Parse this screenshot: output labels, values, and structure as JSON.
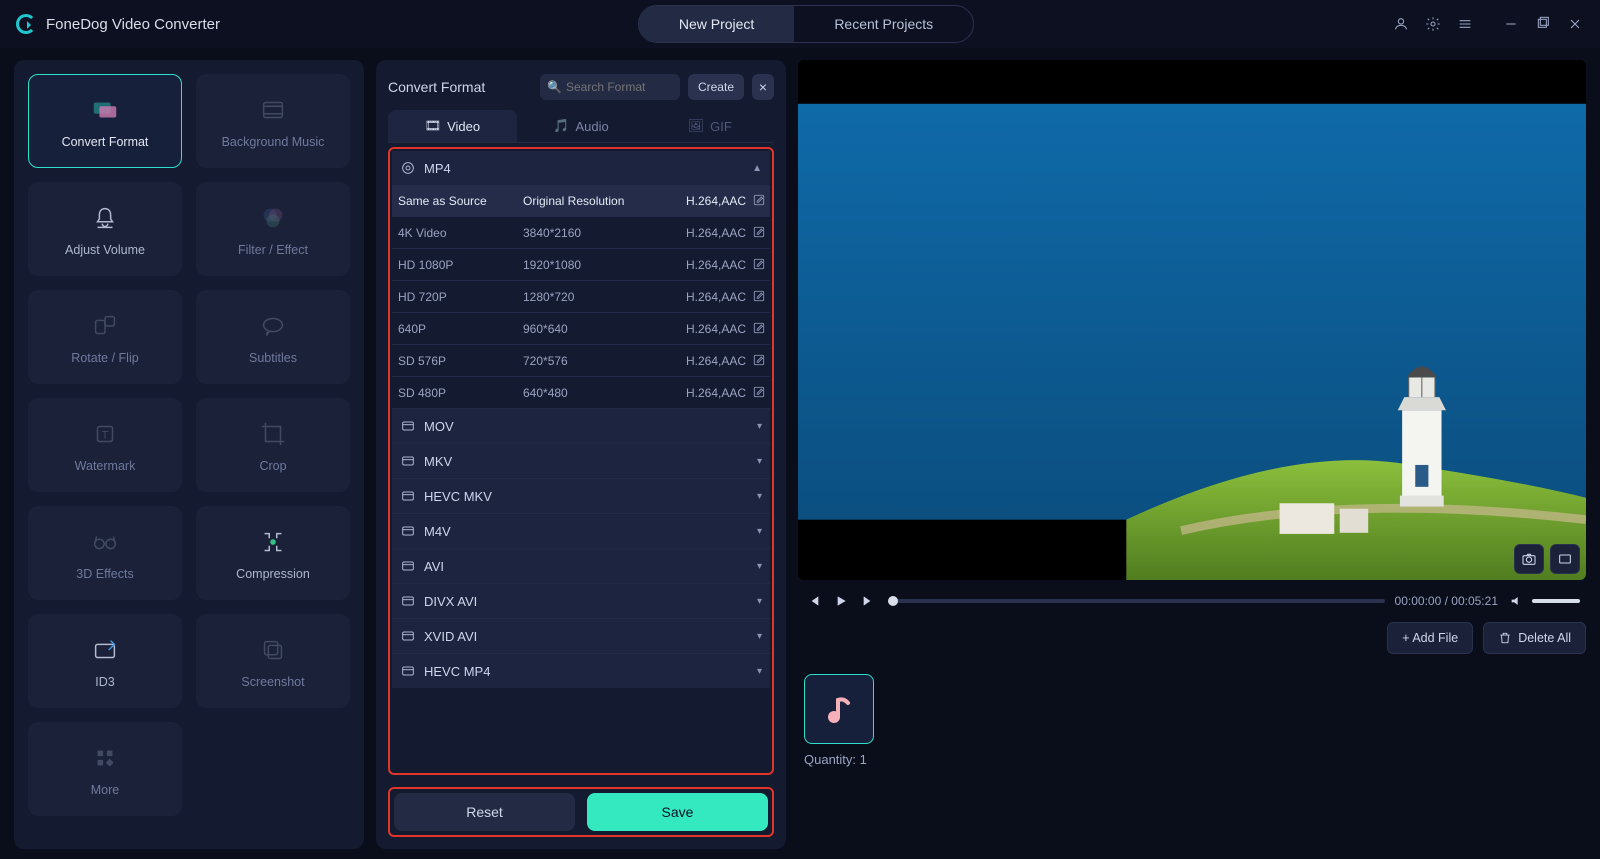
{
  "app_name": "FoneDog Video Converter",
  "topnav": {
    "new_project": "New Project",
    "recent_projects": "Recent Projects"
  },
  "sidebar": {
    "tools": [
      {
        "label": "Convert Format"
      },
      {
        "label": "Background Music"
      },
      {
        "label": "Adjust Volume"
      },
      {
        "label": "Filter / Effect"
      },
      {
        "label": "Rotate / Flip"
      },
      {
        "label": "Subtitles"
      },
      {
        "label": "Watermark"
      },
      {
        "label": "Crop"
      },
      {
        "label": "3D Effects"
      },
      {
        "label": "Compression"
      },
      {
        "label": "ID3"
      },
      {
        "label": "Screenshot"
      },
      {
        "label": "More"
      }
    ]
  },
  "center": {
    "title": "Convert Format",
    "search_placeholder": "Search Format",
    "create": "Create",
    "tabs": {
      "video": "Video",
      "audio": "Audio",
      "gif": "GIF"
    },
    "mp4_header": "MP4",
    "mp4_rows": [
      {
        "name": "Same as Source",
        "res": "Original Resolution",
        "codec": "H.264,AAC"
      },
      {
        "name": "4K Video",
        "res": "3840*2160",
        "codec": "H.264,AAC"
      },
      {
        "name": "HD 1080P",
        "res": "1920*1080",
        "codec": "H.264,AAC"
      },
      {
        "name": "HD 720P",
        "res": "1280*720",
        "codec": "H.264,AAC"
      },
      {
        "name": "640P",
        "res": "960*640",
        "codec": "H.264,AAC"
      },
      {
        "name": "SD 576P",
        "res": "720*576",
        "codec": "H.264,AAC"
      },
      {
        "name": "SD 480P",
        "res": "640*480",
        "codec": "H.264,AAC"
      }
    ],
    "groups": [
      "MOV",
      "MKV",
      "HEVC MKV",
      "M4V",
      "AVI",
      "DIVX AVI",
      "XVID AVI",
      "HEVC MP4"
    ],
    "reset": "Reset",
    "save": "Save"
  },
  "player": {
    "time_current": "00:00:00",
    "time_sep": " / ",
    "time_total": "00:05:21"
  },
  "actions": {
    "add_file": "+ Add File",
    "delete_all": "Delete All"
  },
  "queue": {
    "quantity_label": "Quantity: 1"
  }
}
